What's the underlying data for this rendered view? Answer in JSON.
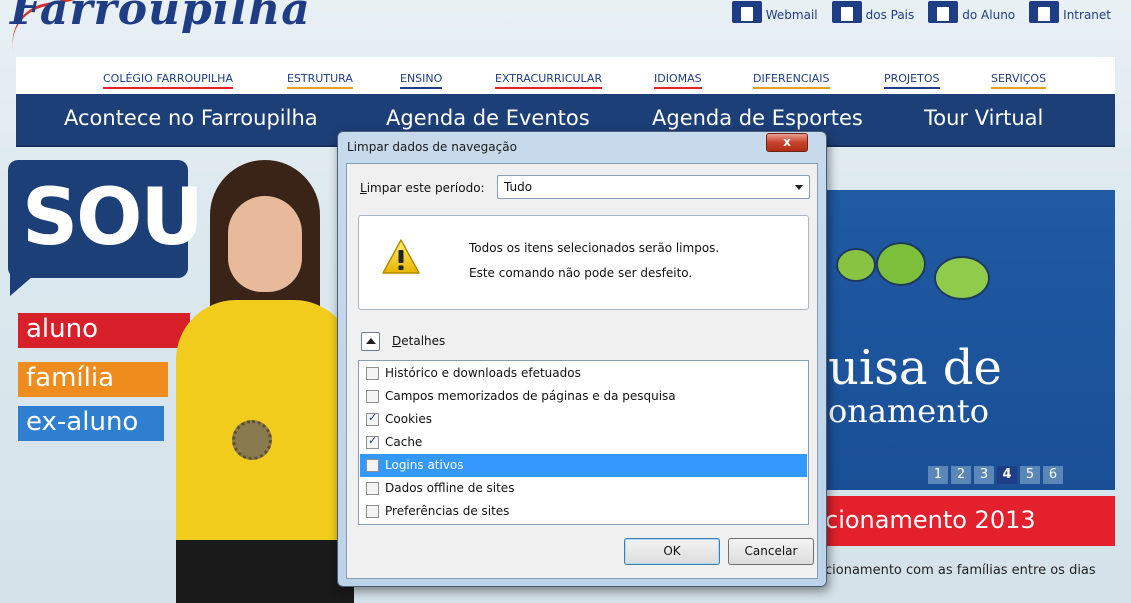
{
  "site": {
    "logo": "Farroupilha",
    "top_links": [
      "Webmail",
      "dos Pais",
      "do Aluno",
      "Intranet"
    ],
    "nav_items": [
      "COLÉGIO FARROUPILHA",
      "ESTRUTURA",
      "ENSINO",
      "EXTRACURRICULAR",
      "IDIOMAS",
      "DIFERENCIAIS",
      "PROJETOS",
      "SERVIÇOS"
    ],
    "nav_big": [
      "Acontece no Farroupilha",
      "Agenda de Eventos",
      "Agenda de Esportes",
      "Tour Virtual"
    ],
    "sou": "SOU",
    "tags": [
      "aluno",
      "família",
      "ex-aluno"
    ],
    "banner_line1": "uisa de",
    "banner_line2": "onamento",
    "pager": [
      "1",
      "2",
      "3",
      "4",
      "5",
      "6"
    ],
    "pager_active": "4",
    "red_band": "cionamento 2013",
    "under_text": "cionamento com as famílias entre os dias"
  },
  "dialog": {
    "title": "Limpar dados de navegação",
    "close_symbol": "x",
    "period_label_access": "L",
    "period_label_rest": "impar este período:",
    "period_value": "Tudo",
    "warning_line1": "Todos os itens selecionados serão limpos.",
    "warning_line2": "Este comando não pode ser desfeito.",
    "details_access": "D",
    "details_rest": "etalhes",
    "items": [
      {
        "label": "Histórico e downloads efetuados",
        "checked": false,
        "selected": false
      },
      {
        "label": "Campos memorizados de páginas e da pesquisa",
        "checked": false,
        "selected": false
      },
      {
        "label": "Cookies",
        "checked": true,
        "selected": false
      },
      {
        "label": "Cache",
        "checked": true,
        "selected": false
      },
      {
        "label": "Logins ativos",
        "checked": false,
        "selected": true
      },
      {
        "label": "Dados offline de sites",
        "checked": false,
        "selected": false
      },
      {
        "label": "Preferências de sites",
        "checked": false,
        "selected": false
      }
    ],
    "ok_label": "OK",
    "cancel_label": "Cancelar"
  },
  "colors": {
    "brand_blue": "#1d3f78",
    "selection": "#3399ff",
    "red": "#e3202b"
  }
}
